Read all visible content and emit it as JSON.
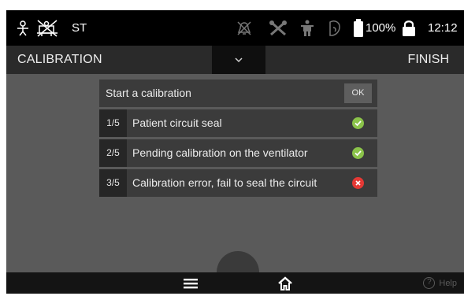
{
  "statusbar": {
    "mode": "ST",
    "battery": "100%",
    "time": "12:12",
    "icons": [
      "patient-icon",
      "patient-disconnected-icon",
      "alarm-off-icon",
      "tools-icon",
      "person-icon",
      "face-mask-icon",
      "battery-icon",
      "lock-icon"
    ]
  },
  "titlebar": {
    "title": "CALIBRATION",
    "finish": "FINISH",
    "toggle_icon": "chevron-down-icon"
  },
  "panel": {
    "header": "Start a calibration",
    "ok": "OK",
    "steps": [
      {
        "num": "1/5",
        "text": "Patient circuit seal",
        "status": "success",
        "color": "#8bc34a"
      },
      {
        "num": "2/5",
        "text": "Pending calibration on the ventilator",
        "status": "success",
        "color": "#8bc34a"
      },
      {
        "num": "3/5",
        "text": "Calibration error, fail to seal the circuit",
        "status": "error",
        "color": "#e53935"
      }
    ]
  },
  "bottombar": {
    "help": "Help",
    "menu_icon": "menu-icon",
    "home_icon": "home-icon",
    "help_icon": "help-icon"
  }
}
